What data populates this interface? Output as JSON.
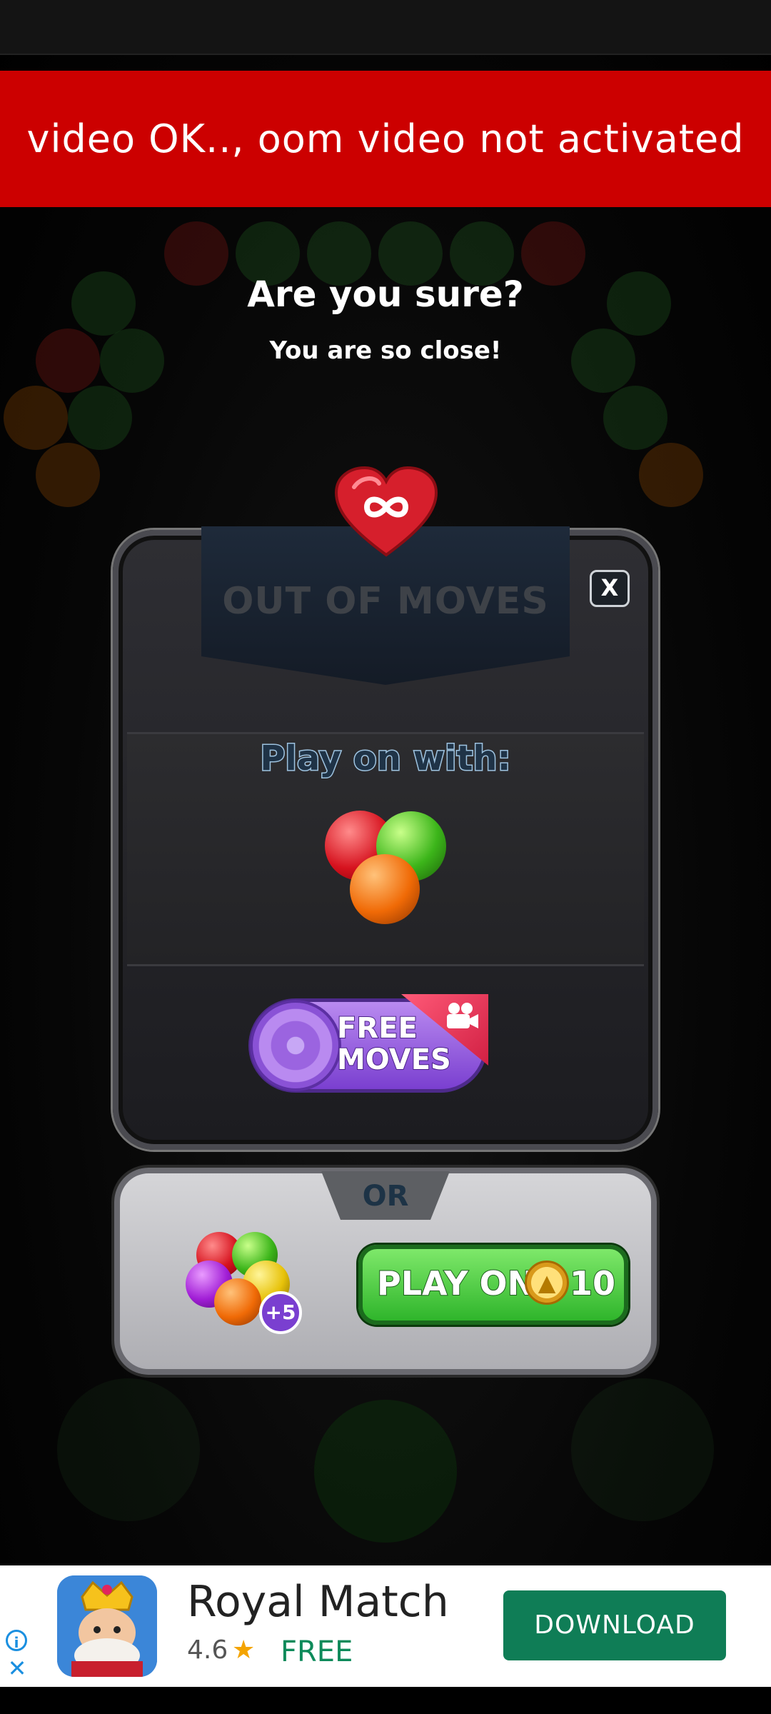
{
  "toast": {
    "message": "video OK.., oom video not activated"
  },
  "confirm": {
    "title": "Are you sure?",
    "subtitle": "You are so close!"
  },
  "panel": {
    "title": "OUT OF MOVES",
    "close_label": "X",
    "play_on_with": "Play on with:",
    "free_moves_label_line1": "FREE",
    "free_moves_label_line2": "MOVES",
    "heart_icon": "infinity-heart-icon"
  },
  "lower_panel": {
    "or_label": "OR",
    "bonus_badge": "+5",
    "play_on_label": "PLAY ON",
    "price": "10",
    "currency_icon": "coin-icon"
  },
  "ad": {
    "app_name": "Royal Match",
    "rating": "4.6",
    "star": "★",
    "price": "FREE",
    "cta": "DOWNLOAD",
    "info_icon": "i",
    "close_icon": "✕"
  },
  "colors": {
    "toast_bg": "#cc0000",
    "free_moves_purple": "#8a52d6",
    "play_on_green": "#2fb52b",
    "ad_cta_green": "#0f7d56"
  }
}
